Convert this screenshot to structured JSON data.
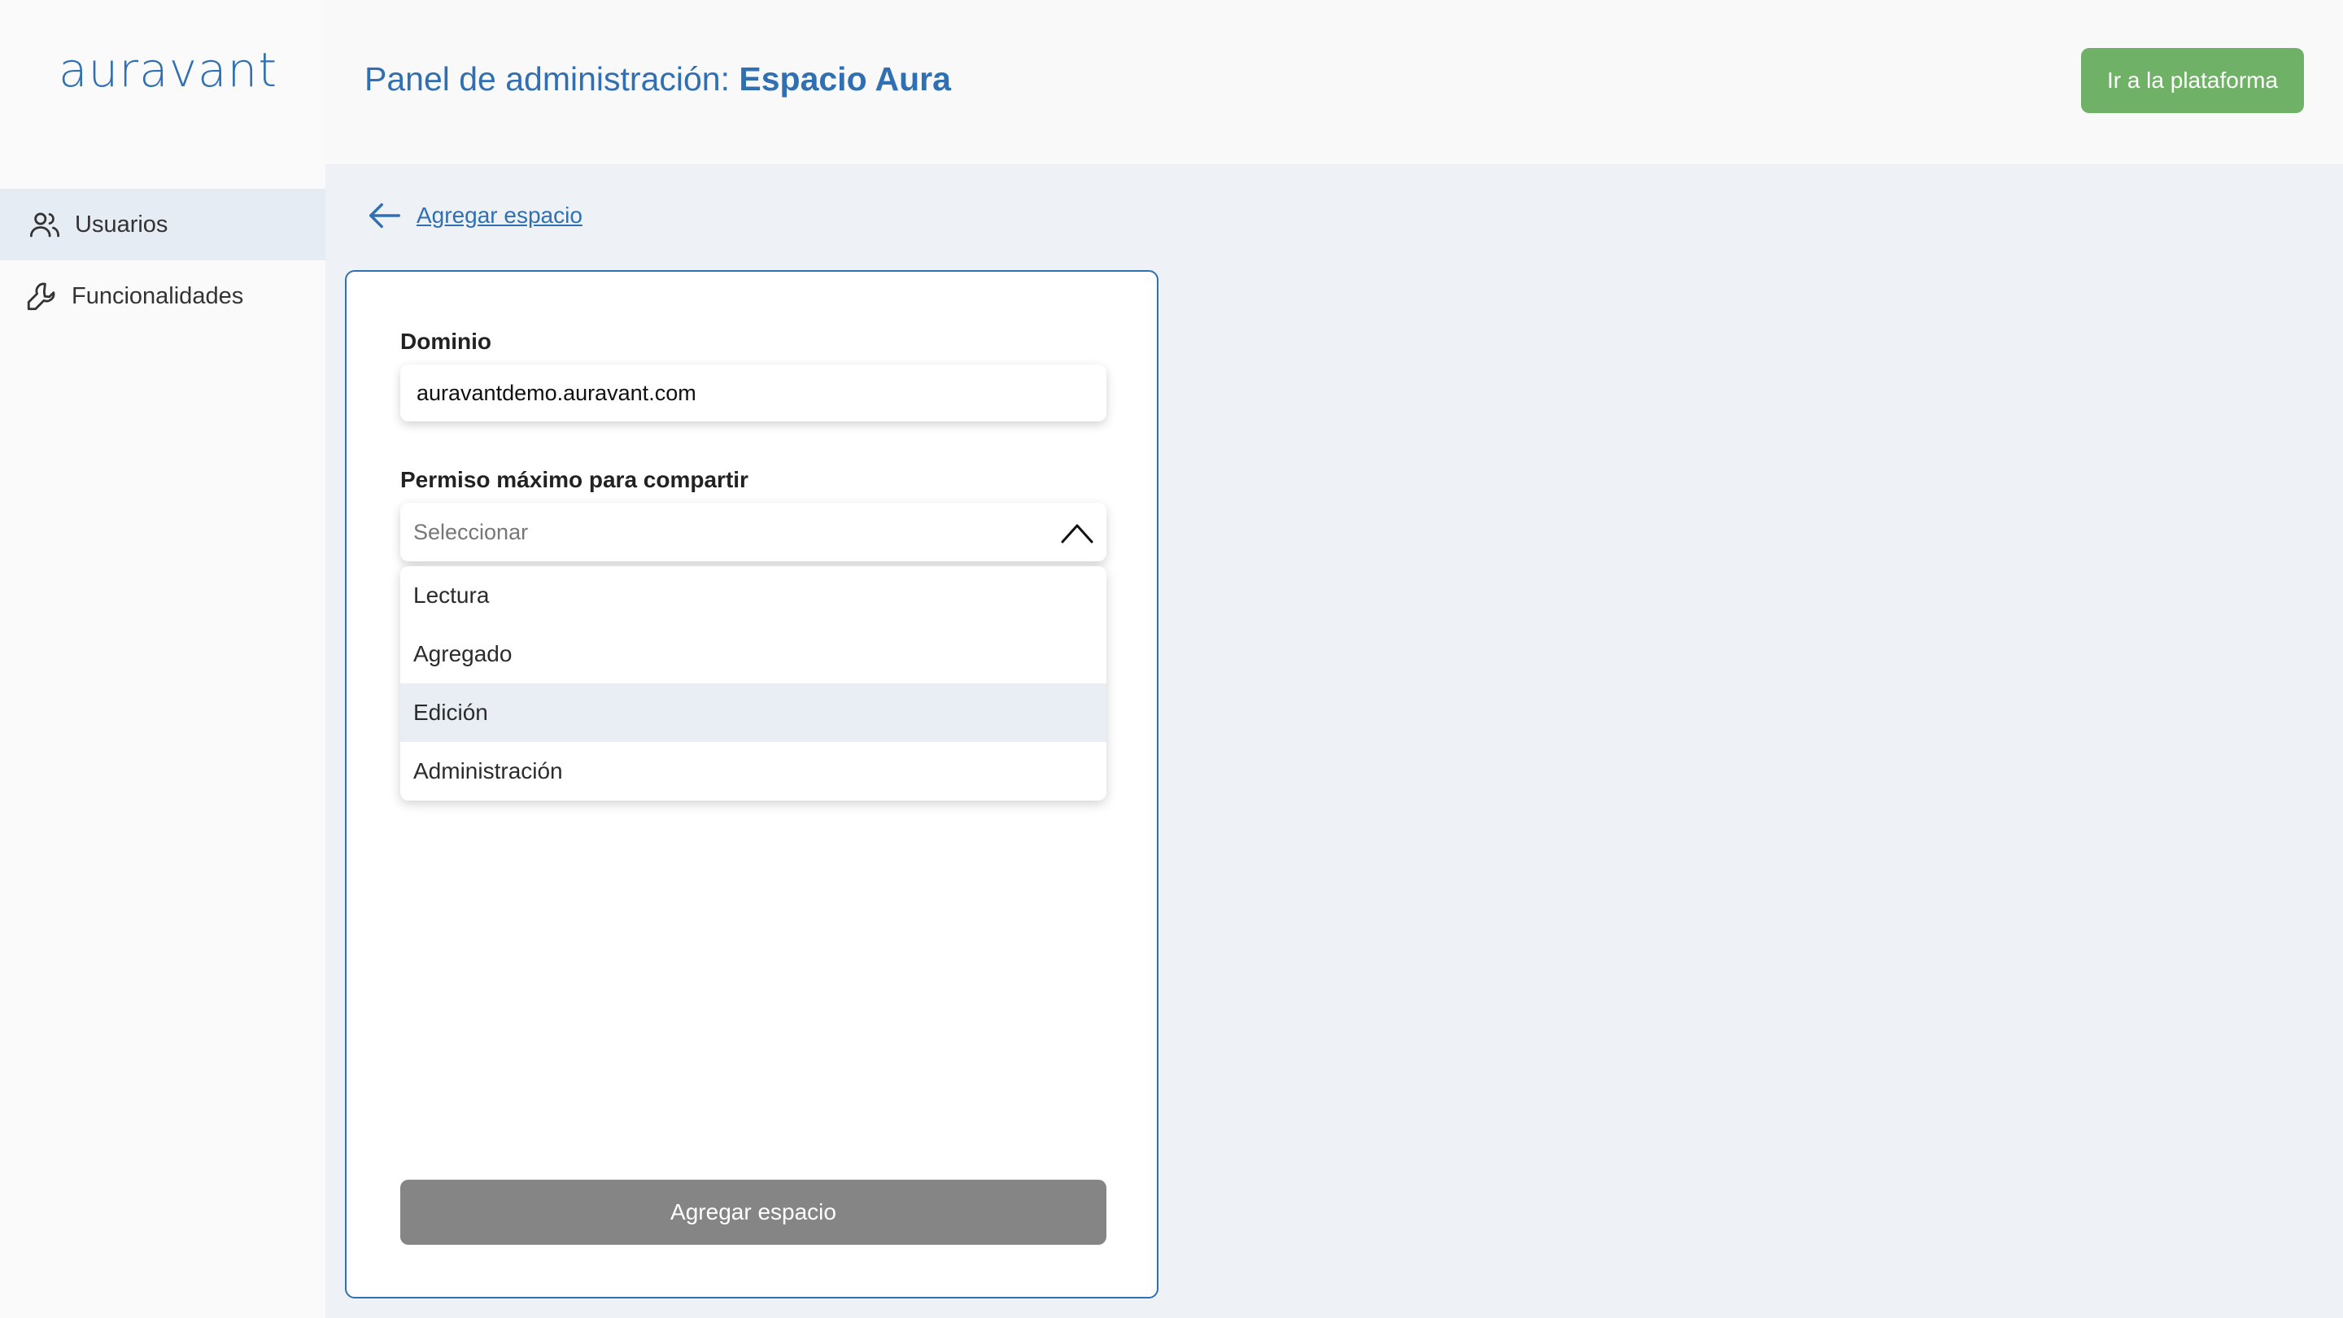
{
  "sidebar": {
    "logo": "auravant",
    "items": [
      {
        "label": "Usuarios",
        "icon": "users-icon"
      },
      {
        "label": "Funcionalidades",
        "icon": "wrench-icon"
      }
    ]
  },
  "header": {
    "title_prefix": "Panel de administración: ",
    "title_space": "Espacio Aura",
    "go_button": "Ir a la plataforma"
  },
  "back_link": "Agregar espacio",
  "form": {
    "domain_label": "Dominio",
    "domain_value": "auravantdemo.auravant.com",
    "permission_label": "Permiso máximo para compartir",
    "permission_placeholder": "Seleccionar",
    "options": [
      "Lectura",
      "Agregado",
      "Edición",
      "Administración"
    ],
    "submit_label": "Agregar espacio"
  },
  "colors": {
    "brand_blue": "#2f6fb2",
    "green_button": "#6fb267",
    "disabled_button": "#858585"
  }
}
